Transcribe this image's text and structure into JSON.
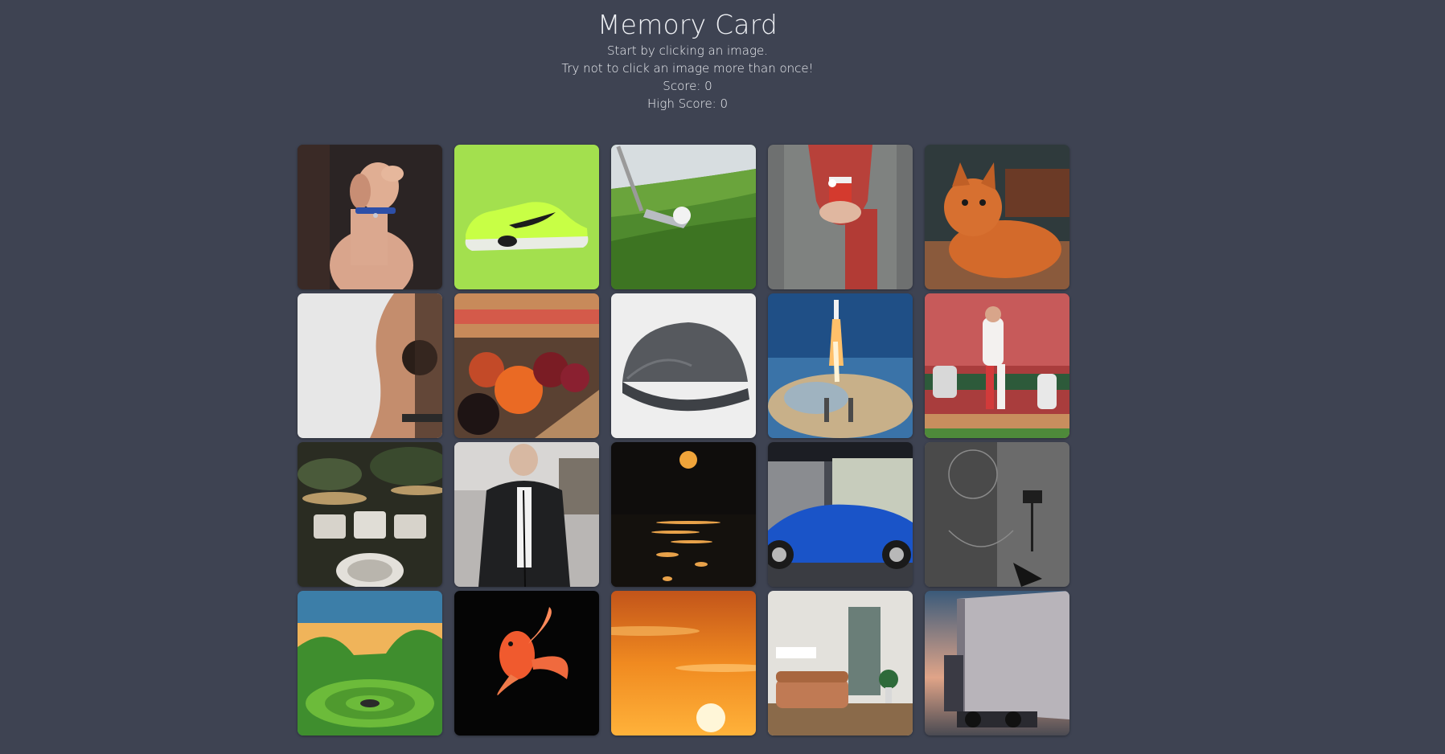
{
  "header": {
    "title": "Memory Card",
    "instruction_1": "Start by clicking an image.",
    "instruction_2": "Try not to click an image more than once!",
    "score": "Score: 0",
    "high_score": "High Score: 0"
  },
  "cards": [
    {
      "subject": "dog"
    },
    {
      "subject": "sneaker"
    },
    {
      "subject": "golf"
    },
    {
      "subject": "scarf-coffee"
    },
    {
      "subject": "cat"
    },
    {
      "subject": "guitar"
    },
    {
      "subject": "bowling-balls"
    },
    {
      "subject": "cap"
    },
    {
      "subject": "rocket"
    },
    {
      "subject": "baseball"
    },
    {
      "subject": "drums"
    },
    {
      "subject": "jacket"
    },
    {
      "subject": "moon-sea"
    },
    {
      "subject": "blue-car"
    },
    {
      "subject": "basketball-court"
    },
    {
      "subject": "green-valley"
    },
    {
      "subject": "goldfish"
    },
    {
      "subject": "sunset"
    },
    {
      "subject": "living-room"
    },
    {
      "subject": "truck"
    }
  ],
  "colors": {
    "background": "#3e4352",
    "text": "#eef0f4"
  }
}
